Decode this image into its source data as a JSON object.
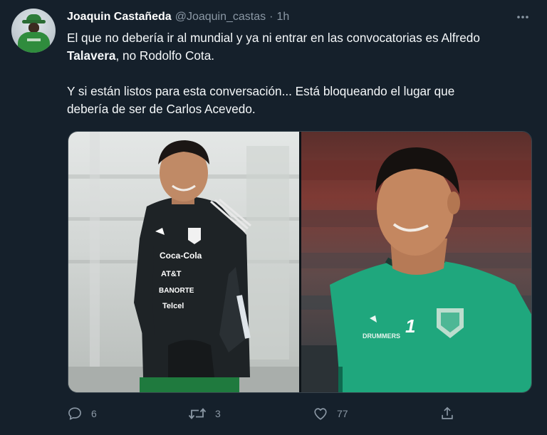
{
  "tweet": {
    "author_name": "Joaquin Castañeda",
    "handle": "@Joaquin_castas",
    "separator": "·",
    "time": "1h",
    "text": {
      "p1_a": "El que no debería ir al mundial y ya ni entrar en las convocatorias es Alfredo",
      "p1_bold": "Talavera",
      "p1_b": ", no Rodolfo Cota.",
      "p2_a": "Y si están listos para esta conversación... Está bloqueando el lugar que",
      "p2_b": "debería de ser de Carlos Acevedo."
    }
  },
  "media": {
    "left_jersey_sponsors": [
      "Coca-Cola",
      "AT&T",
      "BANORTE",
      "Telcel"
    ],
    "right_jersey_number": "1",
    "right_brand": "DRUMMERS"
  },
  "actions": {
    "reply_count": "6",
    "retweet_count": "3",
    "like_count": "77"
  },
  "colors": {
    "background": "#15202b",
    "text": "#ffffff",
    "muted": "#8b98a5",
    "border": "#38444d"
  },
  "icons": [
    "more-icon",
    "reply-icon",
    "retweet-icon",
    "like-icon",
    "share-icon"
  ]
}
